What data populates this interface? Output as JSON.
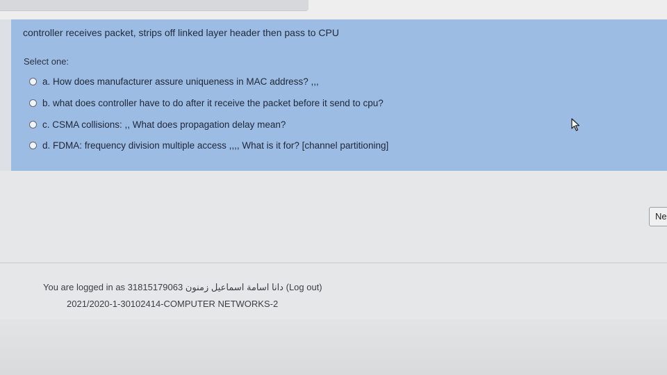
{
  "question": {
    "text": "controller receives packet, strips off linked layer header then pass to CPU",
    "select_one": "Select one:",
    "options": [
      {
        "label": "a. How does manufacturer assure uniqueness in MAC address? ,,,"
      },
      {
        "label": "b. what does controller have to do after it receive the packet before it send to cpu?"
      },
      {
        "label": "c. CSMA collisions: ,, What does propagation delay mean?"
      },
      {
        "label": "d. FDMA: frequency division multiple access ,,,, What is it for? [channel partitioning]"
      }
    ]
  },
  "navigation": {
    "next_label": "Ne"
  },
  "footer": {
    "logged_in_prefix": "You are logged in as 31815179063 دانا اسامة اسماعيل زمنون",
    "logout_label": "(Log out)",
    "course": "2021/2020-1-30102414-COMPUTER NETWORKS-2"
  },
  "colors": {
    "question_panel": "#9cbce4",
    "page_background": "#e6e7e9"
  },
  "icons": {
    "cursor": "mouse-pointer-icon"
  }
}
